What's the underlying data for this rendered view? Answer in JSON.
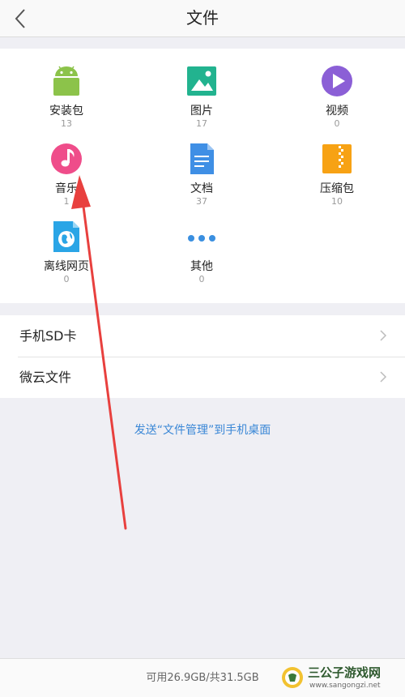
{
  "header": {
    "title": "文件"
  },
  "categories": [
    {
      "label": "安装包",
      "count": "13",
      "icon": "android-icon",
      "color": "#8cc34a"
    },
    {
      "label": "图片",
      "count": "17",
      "icon": "image-icon",
      "color": "#22b38f"
    },
    {
      "label": "视频",
      "count": "0",
      "icon": "play-icon",
      "color": "#8b5fd6"
    },
    {
      "label": "音乐",
      "count": "1",
      "icon": "music-note-icon",
      "color": "#ef4d8a"
    },
    {
      "label": "文档",
      "count": "37",
      "icon": "document-icon",
      "color": "#3f8fe5"
    },
    {
      "label": "压缩包",
      "count": "10",
      "icon": "zip-icon",
      "color": "#f7a214"
    },
    {
      "label": "离线网页",
      "count": "0",
      "icon": "offline-web-icon",
      "color": "#2aa5e6"
    },
    {
      "label": "其他",
      "count": "0",
      "icon": "more-dots-icon",
      "color": "#3a8fe0"
    }
  ],
  "storage_list": [
    {
      "label": "手机SD卡"
    },
    {
      "label": "微云文件"
    }
  ],
  "send_link": "发送“文件管理”到手机桌面",
  "footer": {
    "storage": "可用26.9GB/共31.5GB"
  },
  "watermark": {
    "title": "三公子游戏网",
    "url": "www.sangongzi.net"
  },
  "annotation": {
    "color": "#e8403e"
  }
}
